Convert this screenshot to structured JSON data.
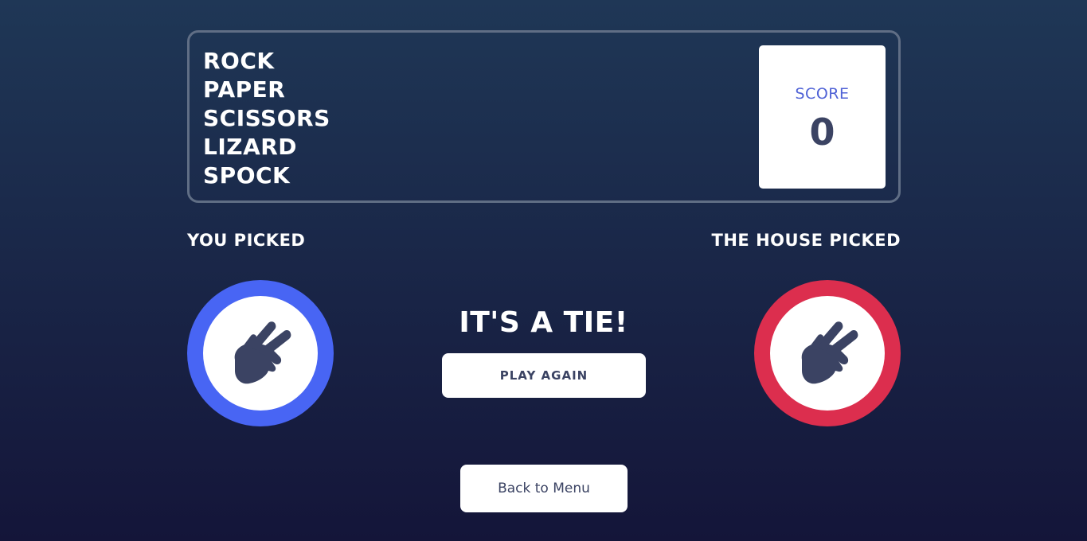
{
  "header": {
    "titles": [
      "ROCK",
      "PAPER",
      "SCISSORS",
      "LIZARD",
      "SPOCK"
    ],
    "score_label": "SCORE",
    "score_value": "0"
  },
  "player": {
    "label": "YOU PICKED",
    "choice_icon": "scissors-hand-icon",
    "ring_color": "#4865f4"
  },
  "house": {
    "label": "THE HOUSE PICKED",
    "choice_icon": "scissors-hand-icon",
    "ring_color": "#dc2e4e"
  },
  "result": {
    "text": "IT'S A TIE!",
    "play_again_label": "PLAY AGAIN"
  },
  "footer": {
    "back_label": "Back to Menu"
  },
  "colors": {
    "background_top": "#1f3756",
    "background_bottom": "#141539",
    "dark_text": "#3b4363",
    "score_text": "#4f62d6"
  }
}
